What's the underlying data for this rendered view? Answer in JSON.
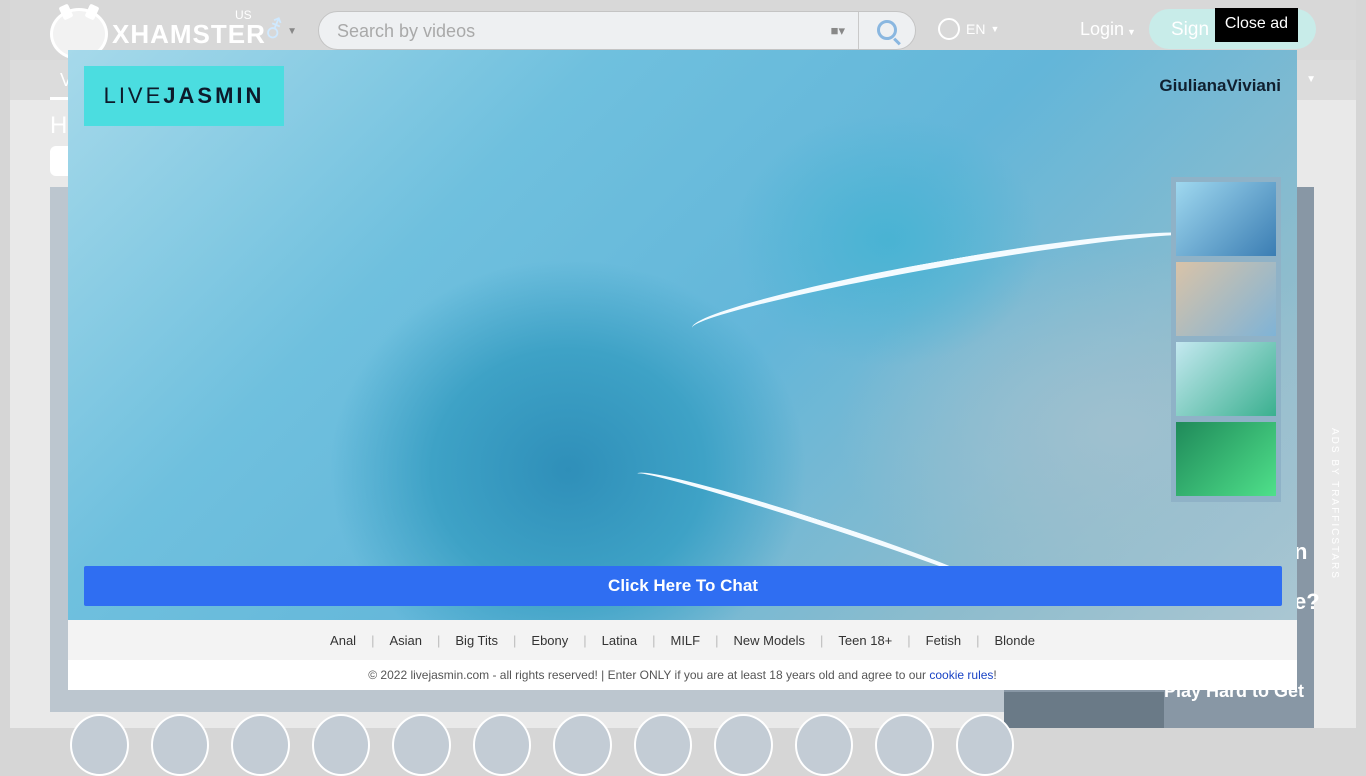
{
  "header": {
    "logo_text": "XHAMSTER",
    "region": "US",
    "search_placeholder": "Search by videos",
    "language": "EN",
    "login_label": "Login",
    "signup_label": "Sign"
  },
  "nav": {
    "first_letter": "V"
  },
  "page": {
    "heading_letter": "H"
  },
  "right_ad": {
    "line1": "n",
    "line2": "e?",
    "tagline": "Play Hard to Get",
    "ads_by": "ADS BY TRAFFICSTARS"
  },
  "ad_modal": {
    "close_label": "Close ad",
    "brand_light": "LIVE",
    "brand_bold": "JASMIN",
    "model_name": "GiulianaViviani",
    "chat_button": "Click Here To Chat",
    "categories": [
      "Anal",
      "Asian",
      "Big Tits",
      "Ebony",
      "Latina",
      "MILF",
      "New Models",
      "Teen 18+",
      "Fetish",
      "Blonde"
    ],
    "footer_text": "© 2022 livejasmin.com - all rights reserved! | Enter ONLY if you are at least 18 years old and agree to our ",
    "footer_link": "cookie rules",
    "footer_end": "!"
  },
  "colors": {
    "accent": "#2f6ef2",
    "brand": "#4bdde0"
  }
}
